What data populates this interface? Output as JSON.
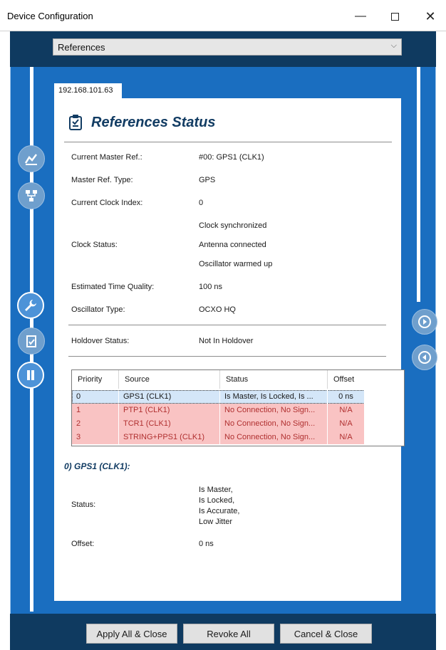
{
  "window": {
    "title": "Device Configuration",
    "min_glyph": "—",
    "close_glyph": "✕"
  },
  "selector": {
    "value": "References",
    "chevron": "⌵"
  },
  "tab": {
    "label": "192.168.101.63"
  },
  "panel": {
    "title": "References Status",
    "rows": [
      {
        "label": "Current Master Ref.:",
        "value": "#00: GPS1 (CLK1)"
      },
      {
        "label": "Master Ref. Type:",
        "value": "GPS"
      },
      {
        "label": "Current Clock Index:",
        "value": "0"
      }
    ],
    "clock_status": {
      "label": "Clock Status:",
      "values": [
        "Clock synchronized",
        "Antenna connected",
        "Oscillator warmed up"
      ]
    },
    "rows2": [
      {
        "label": "Estimated Time Quality:",
        "value": "100 ns"
      },
      {
        "label": "Oscillator Type:",
        "value": "OCXO HQ"
      }
    ],
    "holdover": {
      "label": "Holdover Status:",
      "value": "Not In Holdover"
    },
    "table": {
      "headers": [
        "Priority",
        "Source",
        "Status",
        "Offset"
      ],
      "rows": [
        {
          "priority": "0",
          "source": "GPS1 (CLK1)",
          "status": "Is Master, Is Locked, Is ...",
          "offset": "0 ns",
          "state": "master"
        },
        {
          "priority": "1",
          "source": "PTP1 (CLK1)",
          "status": "No Connection, No Sign...",
          "offset": "N/A",
          "state": "error"
        },
        {
          "priority": "2",
          "source": "TCR1 (CLK1)",
          "status": "No Connection, No Sign...",
          "offset": "N/A",
          "state": "error"
        },
        {
          "priority": "3",
          "source": "STRING+PPS1 (CLK1)",
          "status": "No Connection, No Sign...",
          "offset": "N/A",
          "state": "error"
        }
      ]
    },
    "detail": {
      "title": "0) GPS1 (CLK1):",
      "status_label": "Status:",
      "status_lines": [
        "Is Master,",
        "Is Locked,",
        "Is Accurate,",
        "Low Jitter"
      ],
      "offset_label": "Offset:",
      "offset_value": "0 ns"
    }
  },
  "footer": {
    "apply": "Apply All & Close",
    "revoke": "Revoke All",
    "cancel": "Cancel & Close"
  },
  "colors": {
    "dark_blue": "#0f3a60",
    "main_blue": "#1a6ec0",
    "title_blue": "#123c63",
    "error_row": "#f9c3c3",
    "master_row": "#d4e6f8"
  }
}
